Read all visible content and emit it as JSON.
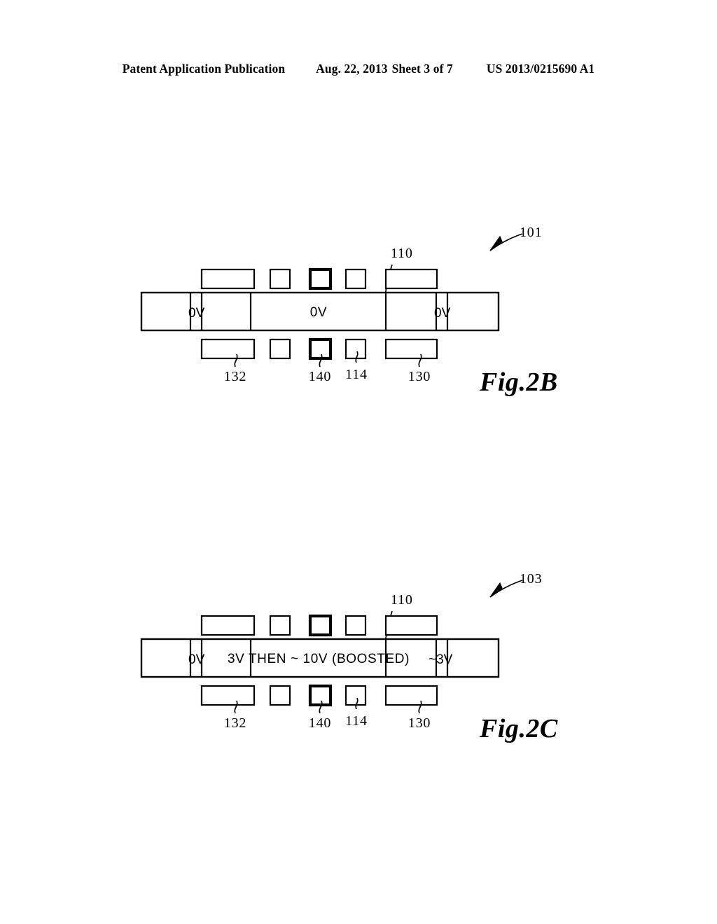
{
  "header": {
    "publication": "Patent Application Publication",
    "date": "Aug. 22, 2013",
    "sheet": "Sheet 3 of 7",
    "patent_number": "US 2013/0215690 A1"
  },
  "figures": [
    {
      "id": "2b",
      "caption": "Fig.2B",
      "assembly_ref": "101",
      "channel_ref": "110",
      "bar_labels": {
        "left_select": "0V",
        "center": "0V",
        "right_select": "0V"
      },
      "box_refs": {
        "left_wide": "132",
        "center_bold": "140",
        "right_small": "114",
        "right_wide": "130"
      }
    },
    {
      "id": "2c",
      "caption": "Fig.2C",
      "assembly_ref": "103",
      "channel_ref": "110",
      "bar_labels": {
        "left_select": "0V",
        "center": "3V THEN ~ 10V (BOOSTED)",
        "right_select": "~3V"
      },
      "box_refs": {
        "left_wide": "132",
        "center_bold": "140",
        "right_small": "114",
        "right_wide": "130"
      }
    }
  ]
}
